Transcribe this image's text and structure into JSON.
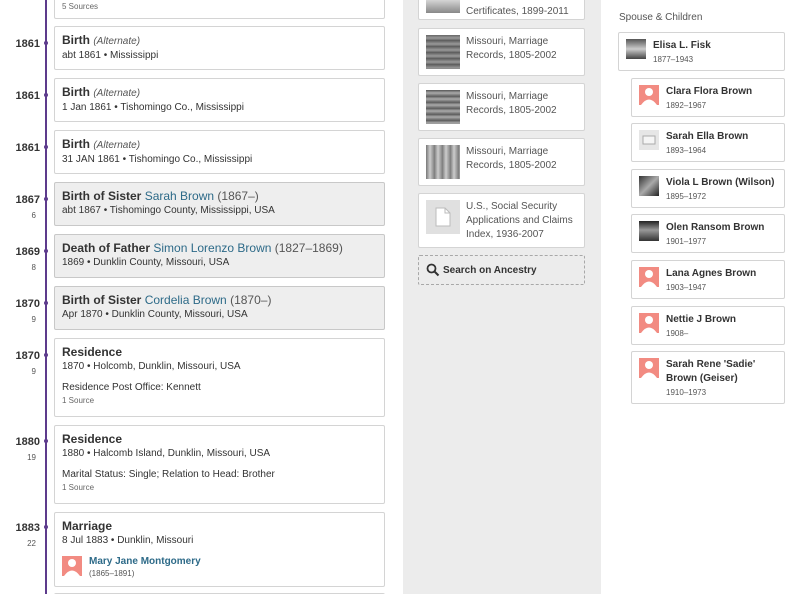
{
  "timeline": [
    {
      "year": "",
      "age": "",
      "title": "",
      "sources": "5 Sources"
    },
    {
      "year": "1861",
      "age": "",
      "title": "Birth",
      "alt": "(Alternate)",
      "sub": "abt 1861 • Mississippi"
    },
    {
      "year": "1861",
      "age": "",
      "title": "Birth",
      "alt": "(Alternate)",
      "sub": "1 Jan 1861 • Tishomingo Co., Mississippi"
    },
    {
      "year": "1861",
      "age": "",
      "title": "Birth",
      "alt": "(Alternate)",
      "sub": "31 JAN 1861 • Tishomingo Co., Mississippi"
    },
    {
      "year": "1867",
      "age": "6",
      "prefix": "Birth of Sister",
      "link": "Sarah Brown",
      "dates": "(1867–)",
      "sub": "abt 1867 • Tishomingo County, Mississippi, USA"
    },
    {
      "year": "1869",
      "age": "8",
      "prefix": "Death of Father",
      "link": "Simon Lorenzo Brown",
      "dates": "(1827–1869)",
      "sub": "1869 • Dunklin County, Missouri, USA"
    },
    {
      "year": "1870",
      "age": "9",
      "prefix": "Birth of Sister",
      "link": "Cordelia Brown",
      "dates": "(1870–)",
      "sub": "Apr 1870 • Dunklin County, Missouri, USA"
    },
    {
      "year": "1870",
      "age": "9",
      "title": "Residence",
      "sub": "1870 • Holcomb, Dunklin, Missouri, USA",
      "extra": "Residence Post Office: Kennett",
      "sources": "1 Source"
    },
    {
      "year": "1880",
      "age": "19",
      "title": "Residence",
      "sub": "1880 • Halcomb Island, Dunklin, Missouri, USA",
      "extra": "Marital Status: Single; Relation to Head: Brother",
      "sources": "1 Source"
    },
    {
      "year": "1883",
      "age": "22",
      "title": "Marriage",
      "sub": "8 Jul 1883 • Dunklin, Missouri",
      "spouse_name": "Mary Jane Montgomery",
      "spouse_dates": "(1865–1891)"
    }
  ],
  "sources_list": [
    {
      "title": "Certificates, 1899-2011",
      "thumb": "document-image-thumbnail"
    },
    {
      "title": "Missouri, Marriage Records, 1805-2002",
      "thumb": "marriage-record-thumbnail"
    },
    {
      "title": "Missouri, Marriage Records, 1805-2002",
      "thumb": "marriage-record-thumbnail"
    },
    {
      "title": "Missouri, Marriage Records, 1805-2002",
      "thumb": "marriage-record-thumbnail"
    },
    {
      "title": "U.S., Social Security Applications and Claims Index, 1936-2007",
      "thumb": "document-icon"
    }
  ],
  "search": {
    "label": "Search on Ancestry",
    "icon": "search-icon"
  },
  "family": {
    "label": "Spouse & Children",
    "members": [
      {
        "name": "Elisa L. Fisk",
        "dates": "1877–1943",
        "avatar": "photo"
      },
      {
        "name": "Clara Flora Brown",
        "dates": "1892–1967",
        "avatar": "female-silhouette"
      },
      {
        "name": "Sarah Ella Brown",
        "dates": "1893–1964",
        "avatar": "record-image"
      },
      {
        "name": "Viola L Brown (Wilson)",
        "dates": "1895–1972",
        "avatar": "photo"
      },
      {
        "name": "Olen Ransom Brown",
        "dates": "1901–1977",
        "avatar": "photo"
      },
      {
        "name": "Lana Agnes Brown",
        "dates": "1903–1947",
        "avatar": "female-silhouette"
      },
      {
        "name": "Nettie J Brown",
        "dates": "1908–",
        "avatar": "female-silhouette"
      },
      {
        "name": "Sarah Rene 'Sadie' Brown (Geiser)",
        "dates": "1910–1973",
        "avatar": "female-silhouette"
      }
    ]
  },
  "colors": {
    "timeline": "#5d3b8c",
    "link": "#2d6a88",
    "female_avatar": "#f28b82",
    "mid_column": "#ececec"
  }
}
